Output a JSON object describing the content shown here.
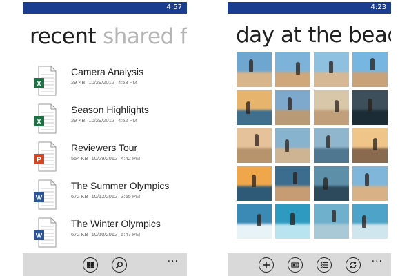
{
  "left_screen": {
    "status_time": "4:57",
    "pivot_active": "recent",
    "pivot_next": "shared f",
    "files": [
      {
        "name": "Camera Analysis",
        "size": "29 KB",
        "date": "10/29/2012",
        "time": "4:53 PM",
        "type": "excel",
        "letter": "X",
        "color": "#1e7145"
      },
      {
        "name": "Season Highlights",
        "size": "29 KB",
        "date": "10/29/2012",
        "time": "4:52 PM",
        "type": "excel",
        "letter": "X",
        "color": "#1e7145"
      },
      {
        "name": "Reviewers Tour",
        "size": "554 KB",
        "date": "10/29/2012",
        "time": "4:42 PM",
        "type": "powerpoint",
        "letter": "P",
        "color": "#d24726"
      },
      {
        "name": "The Summer Olympics",
        "size": "672 KB",
        "date": "10/12/2012",
        "time": "3:55 PM",
        "type": "word",
        "letter": "W",
        "color": "#2b579a"
      },
      {
        "name": "The Winter Olympics",
        "size": "672 KB",
        "date": "10/10/2012",
        "time": "5:47 PM",
        "type": "word",
        "letter": "W",
        "color": "#2b579a"
      }
    ],
    "appbar": {
      "buttons": [
        "list-view-icon",
        "search-icon"
      ],
      "more": "..."
    }
  },
  "right_screen": {
    "status_time": "4:23",
    "title": "day at the beac",
    "photos": [
      {
        "sky": "#6fa6cf",
        "ground": "#d8b58a"
      },
      {
        "sky": "#7db3d8",
        "ground": "#cfa77a"
      },
      {
        "sky": "#8ec1e0",
        "ground": "#d7b894"
      },
      {
        "sky": "#76b6e0",
        "ground": "#c9a27a"
      },
      {
        "sky": "#e7b46e",
        "ground": "#3f6f8c"
      },
      {
        "sky": "#7fa9cc",
        "ground": "#b89a76"
      },
      {
        "sky": "#d9c7a9",
        "ground": "#c29f7b"
      },
      {
        "sky": "#3c4f5a",
        "ground": "#1c2c37"
      },
      {
        "sky": "#e6c29b",
        "ground": "#b8946d"
      },
      {
        "sky": "#87b3cf",
        "ground": "#cfb494"
      },
      {
        "sky": "#8fb6cc",
        "ground": "#4f7790"
      },
      {
        "sky": "#f0c58a",
        "ground": "#8a6a4f"
      },
      {
        "sky": "#f0a64b",
        "ground": "#2e5a78"
      },
      {
        "sky": "#3d6d8e",
        "ground": "#c59c74"
      },
      {
        "sky": "#5e8fa8",
        "ground": "#2c4a5c"
      },
      {
        "sky": "#80b6d9",
        "ground": "#d8b286"
      },
      {
        "sky": "#3b89b5",
        "ground": "#e8f3f8"
      },
      {
        "sky": "#2f9abf",
        "ground": "#b7e4ee"
      },
      {
        "sky": "#6fb0cc",
        "ground": "#a9c9d6"
      },
      {
        "sky": "#4da3c8",
        "ground": "#cfe6ee"
      }
    ],
    "appbar": {
      "buttons": [
        "add-icon",
        "slideshow-icon",
        "select-icon",
        "sync-icon"
      ],
      "more": "..."
    }
  }
}
